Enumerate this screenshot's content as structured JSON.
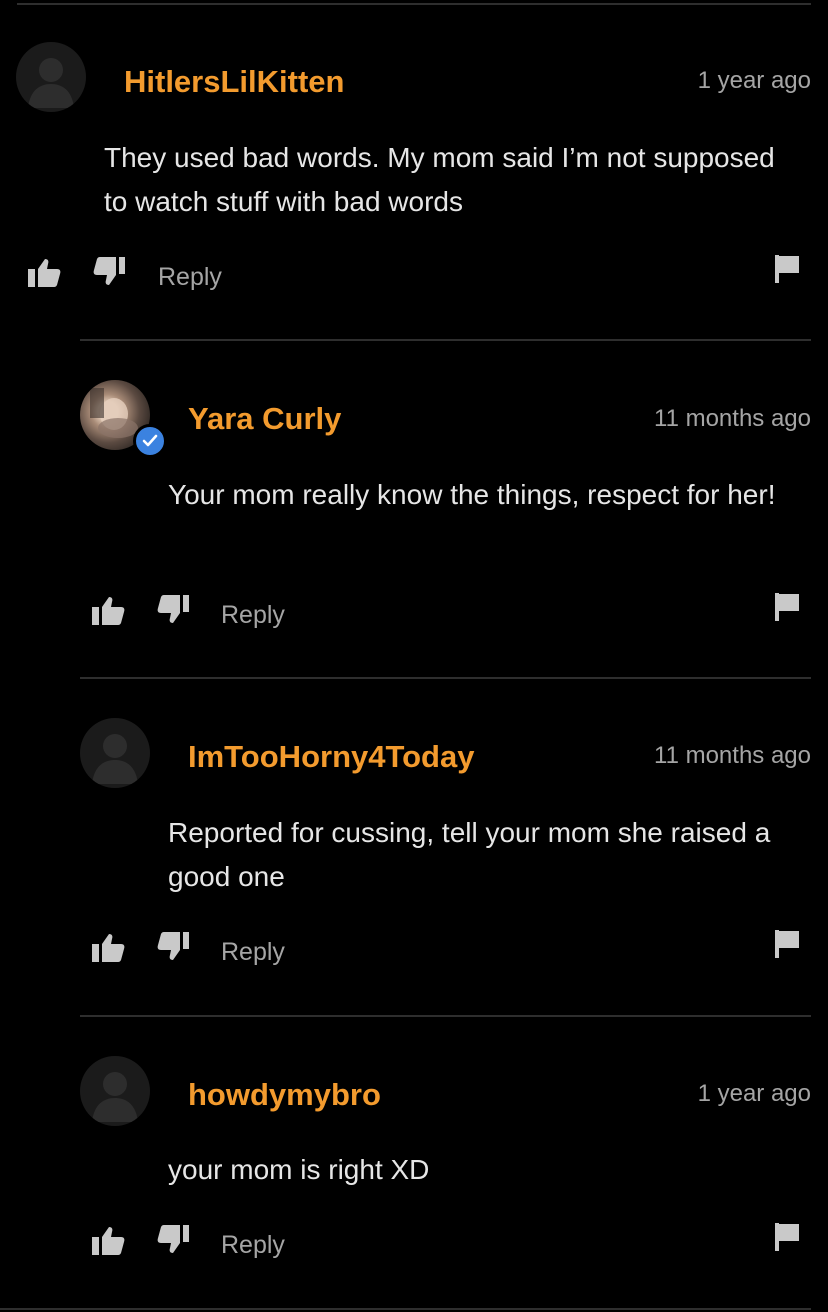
{
  "comments": [
    {
      "username": "HitlersLilKitten",
      "time": "1 year ago",
      "text": "They used bad words. My mom said I’m not supposed to watch stuff with bad words",
      "reply_label": "Reply",
      "avatar": "default-avatar"
    },
    {
      "username": "Yara Curly",
      "time": "11 months ago",
      "text": "Your mom really know the things, respect for her!",
      "reply_label": "Reply",
      "avatar": "photo-avatar",
      "verified": true
    },
    {
      "username": "ImTooHorny4Today",
      "time": "11 months ago",
      "text": "Reported for cussing, tell your mom she raised a good one",
      "reply_label": "Reply",
      "avatar": "default-avatar"
    },
    {
      "username": "howdymybro",
      "time": "1 year ago",
      "text": "your mom is right XD",
      "reply_label": "Reply",
      "avatar": "default-avatar"
    }
  ],
  "icons": {
    "like": "thumbs-up-icon",
    "dislike": "thumbs-down-icon",
    "flag": "flag-icon",
    "verified": "verified-check-icon"
  },
  "colors": {
    "background": "#000000",
    "username": "#f39b2e",
    "meta_text": "#a5a5a5",
    "body_text": "#e6e6e6",
    "divider": "#2e2e2e",
    "verified_badge": "#3b82e0"
  }
}
